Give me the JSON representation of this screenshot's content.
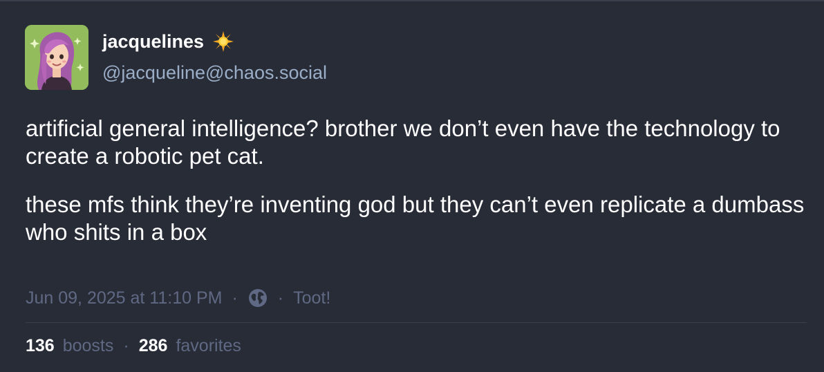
{
  "author": {
    "display_name": "jacquelines",
    "emoji_icon": "sun-icon",
    "handle": "@jacqueline@chaos.social"
  },
  "post": {
    "paragraphs": [
      "artificial general intelligence? brother we don’t even have the technology to create a robotic pet cat.",
      "these mfs think they’re inventing god but they can’t even replicate a dumbass who shits in a box"
    ],
    "timestamp": "Jun 09, 2025 at 11:10 PM",
    "separator": "·",
    "visibility_icon": "globe-icon",
    "app": "Toot!"
  },
  "stats": {
    "boosts_count": "136",
    "boosts_label": "boosts",
    "separator": "·",
    "favorites_count": "286",
    "favorites_label": "favorites"
  },
  "colors": {
    "background": "#282c37",
    "secondary_text": "#9baec8",
    "muted_text": "#606984"
  }
}
